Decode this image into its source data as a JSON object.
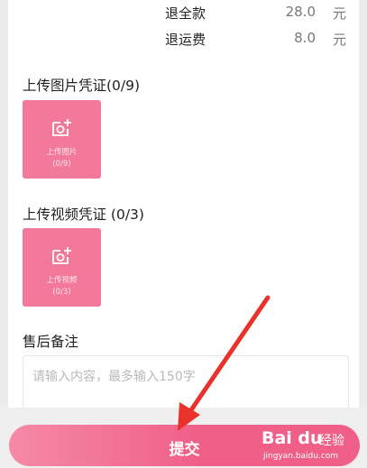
{
  "refund": {
    "rows": [
      {
        "label": "退全款",
        "value": "28.0",
        "unit": "元"
      },
      {
        "label": "退运费",
        "value": "8.0",
        "unit": "元"
      }
    ]
  },
  "image_upload": {
    "title": "上传图片凭证(0/9)",
    "button_label": "上传图片",
    "count": "(0/9)"
  },
  "video_upload": {
    "title": "上传视频凭证 (0/3)",
    "button_label": "上传视频",
    "count": "(0/3)"
  },
  "remarks": {
    "title": "售后备注",
    "placeholder": "请输入内容，最多输入150字"
  },
  "submit": {
    "label": "提交"
  },
  "watermark": {
    "logo": "Bai du",
    "label": "经验",
    "url": "jingyan.baidu.com"
  },
  "colors": {
    "accent": "#f2799a",
    "button": "#ef5f87",
    "annotation_arrow": "#e8322b"
  }
}
